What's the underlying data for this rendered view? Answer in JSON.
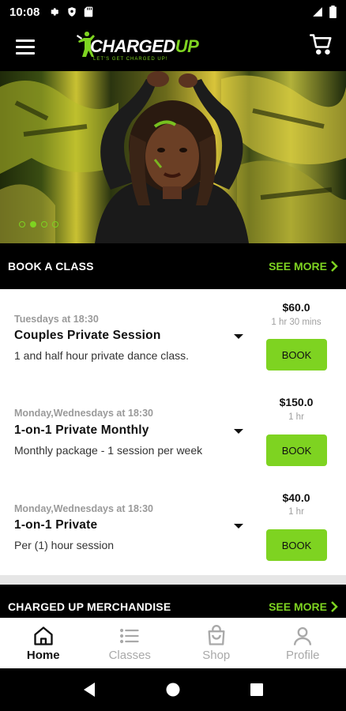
{
  "status_bar": {
    "time": "10:08"
  },
  "header": {
    "logo_text_main": "CHARGED",
    "logo_text_accent": "UP",
    "logo_tagline": "LET'S GET CHARGED UP!"
  },
  "hero": {
    "slide_count": 4,
    "active_slide": 2
  },
  "book_section": {
    "title": "BOOK A CLASS",
    "see_more": "SEE MORE"
  },
  "classes": [
    {
      "schedule": "Tuesdays at 18:30",
      "name": "Couples Private Session",
      "description": "1 and half hour private dance class.",
      "price": "$60.0",
      "duration": "1 hr 30 mins",
      "book_label": "BOOK"
    },
    {
      "schedule": "Monday,Wednesdays at 18:30",
      "name": "1-on-1 Private Monthly",
      "description": "Monthly package - 1 session per week",
      "price": "$150.0",
      "duration": "1 hr",
      "book_label": "BOOK"
    },
    {
      "schedule": "Monday,Wednesdays at 18:30",
      "name": "1-on-1 Private",
      "description": "Per (1) hour session",
      "price": "$40.0",
      "duration": "1 hr",
      "book_label": "BOOK"
    }
  ],
  "merch_section": {
    "title": "CHARGED UP MERCHANDISE",
    "see_more": "SEE MORE"
  },
  "bottom_nav": [
    {
      "label": "Home",
      "icon": "home-icon",
      "active": true
    },
    {
      "label": "Classes",
      "icon": "list-icon",
      "active": false
    },
    {
      "label": "Shop",
      "icon": "shopping-bag-icon",
      "active": false
    },
    {
      "label": "Profile",
      "icon": "person-icon",
      "active": false
    }
  ],
  "colors": {
    "accent": "#7ed321",
    "background": "#000000",
    "card": "#ffffff",
    "muted_text": "#9a9a9a"
  }
}
